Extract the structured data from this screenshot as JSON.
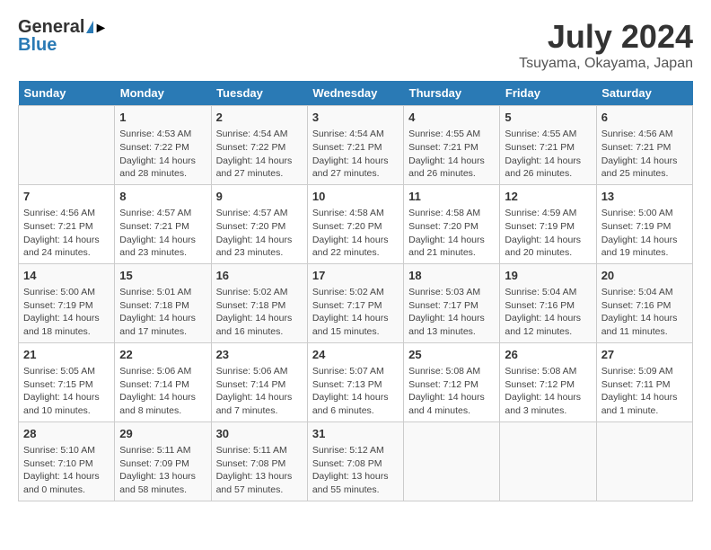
{
  "header": {
    "logo_general": "General",
    "logo_blue": "Blue",
    "month": "July 2024",
    "location": "Tsuyama, Okayama, Japan"
  },
  "days_of_week": [
    "Sunday",
    "Monday",
    "Tuesday",
    "Wednesday",
    "Thursday",
    "Friday",
    "Saturday"
  ],
  "weeks": [
    [
      {
        "day": "",
        "content": ""
      },
      {
        "day": "1",
        "content": "Sunrise: 4:53 AM\nSunset: 7:22 PM\nDaylight: 14 hours\nand 28 minutes."
      },
      {
        "day": "2",
        "content": "Sunrise: 4:54 AM\nSunset: 7:22 PM\nDaylight: 14 hours\nand 27 minutes."
      },
      {
        "day": "3",
        "content": "Sunrise: 4:54 AM\nSunset: 7:21 PM\nDaylight: 14 hours\nand 27 minutes."
      },
      {
        "day": "4",
        "content": "Sunrise: 4:55 AM\nSunset: 7:21 PM\nDaylight: 14 hours\nand 26 minutes."
      },
      {
        "day": "5",
        "content": "Sunrise: 4:55 AM\nSunset: 7:21 PM\nDaylight: 14 hours\nand 26 minutes."
      },
      {
        "day": "6",
        "content": "Sunrise: 4:56 AM\nSunset: 7:21 PM\nDaylight: 14 hours\nand 25 minutes."
      }
    ],
    [
      {
        "day": "7",
        "content": "Sunrise: 4:56 AM\nSunset: 7:21 PM\nDaylight: 14 hours\nand 24 minutes."
      },
      {
        "day": "8",
        "content": "Sunrise: 4:57 AM\nSunset: 7:21 PM\nDaylight: 14 hours\nand 23 minutes."
      },
      {
        "day": "9",
        "content": "Sunrise: 4:57 AM\nSunset: 7:20 PM\nDaylight: 14 hours\nand 23 minutes."
      },
      {
        "day": "10",
        "content": "Sunrise: 4:58 AM\nSunset: 7:20 PM\nDaylight: 14 hours\nand 22 minutes."
      },
      {
        "day": "11",
        "content": "Sunrise: 4:58 AM\nSunset: 7:20 PM\nDaylight: 14 hours\nand 21 minutes."
      },
      {
        "day": "12",
        "content": "Sunrise: 4:59 AM\nSunset: 7:19 PM\nDaylight: 14 hours\nand 20 minutes."
      },
      {
        "day": "13",
        "content": "Sunrise: 5:00 AM\nSunset: 7:19 PM\nDaylight: 14 hours\nand 19 minutes."
      }
    ],
    [
      {
        "day": "14",
        "content": "Sunrise: 5:00 AM\nSunset: 7:19 PM\nDaylight: 14 hours\nand 18 minutes."
      },
      {
        "day": "15",
        "content": "Sunrise: 5:01 AM\nSunset: 7:18 PM\nDaylight: 14 hours\nand 17 minutes."
      },
      {
        "day": "16",
        "content": "Sunrise: 5:02 AM\nSunset: 7:18 PM\nDaylight: 14 hours\nand 16 minutes."
      },
      {
        "day": "17",
        "content": "Sunrise: 5:02 AM\nSunset: 7:17 PM\nDaylight: 14 hours\nand 15 minutes."
      },
      {
        "day": "18",
        "content": "Sunrise: 5:03 AM\nSunset: 7:17 PM\nDaylight: 14 hours\nand 13 minutes."
      },
      {
        "day": "19",
        "content": "Sunrise: 5:04 AM\nSunset: 7:16 PM\nDaylight: 14 hours\nand 12 minutes."
      },
      {
        "day": "20",
        "content": "Sunrise: 5:04 AM\nSunset: 7:16 PM\nDaylight: 14 hours\nand 11 minutes."
      }
    ],
    [
      {
        "day": "21",
        "content": "Sunrise: 5:05 AM\nSunset: 7:15 PM\nDaylight: 14 hours\nand 10 minutes."
      },
      {
        "day": "22",
        "content": "Sunrise: 5:06 AM\nSunset: 7:14 PM\nDaylight: 14 hours\nand 8 minutes."
      },
      {
        "day": "23",
        "content": "Sunrise: 5:06 AM\nSunset: 7:14 PM\nDaylight: 14 hours\nand 7 minutes."
      },
      {
        "day": "24",
        "content": "Sunrise: 5:07 AM\nSunset: 7:13 PM\nDaylight: 14 hours\nand 6 minutes."
      },
      {
        "day": "25",
        "content": "Sunrise: 5:08 AM\nSunset: 7:12 PM\nDaylight: 14 hours\nand 4 minutes."
      },
      {
        "day": "26",
        "content": "Sunrise: 5:08 AM\nSunset: 7:12 PM\nDaylight: 14 hours\nand 3 minutes."
      },
      {
        "day": "27",
        "content": "Sunrise: 5:09 AM\nSunset: 7:11 PM\nDaylight: 14 hours\nand 1 minute."
      }
    ],
    [
      {
        "day": "28",
        "content": "Sunrise: 5:10 AM\nSunset: 7:10 PM\nDaylight: 14 hours\nand 0 minutes."
      },
      {
        "day": "29",
        "content": "Sunrise: 5:11 AM\nSunset: 7:09 PM\nDaylight: 13 hours\nand 58 minutes."
      },
      {
        "day": "30",
        "content": "Sunrise: 5:11 AM\nSunset: 7:08 PM\nDaylight: 13 hours\nand 57 minutes."
      },
      {
        "day": "31",
        "content": "Sunrise: 5:12 AM\nSunset: 7:08 PM\nDaylight: 13 hours\nand 55 minutes."
      },
      {
        "day": "",
        "content": ""
      },
      {
        "day": "",
        "content": ""
      },
      {
        "day": "",
        "content": ""
      }
    ]
  ]
}
